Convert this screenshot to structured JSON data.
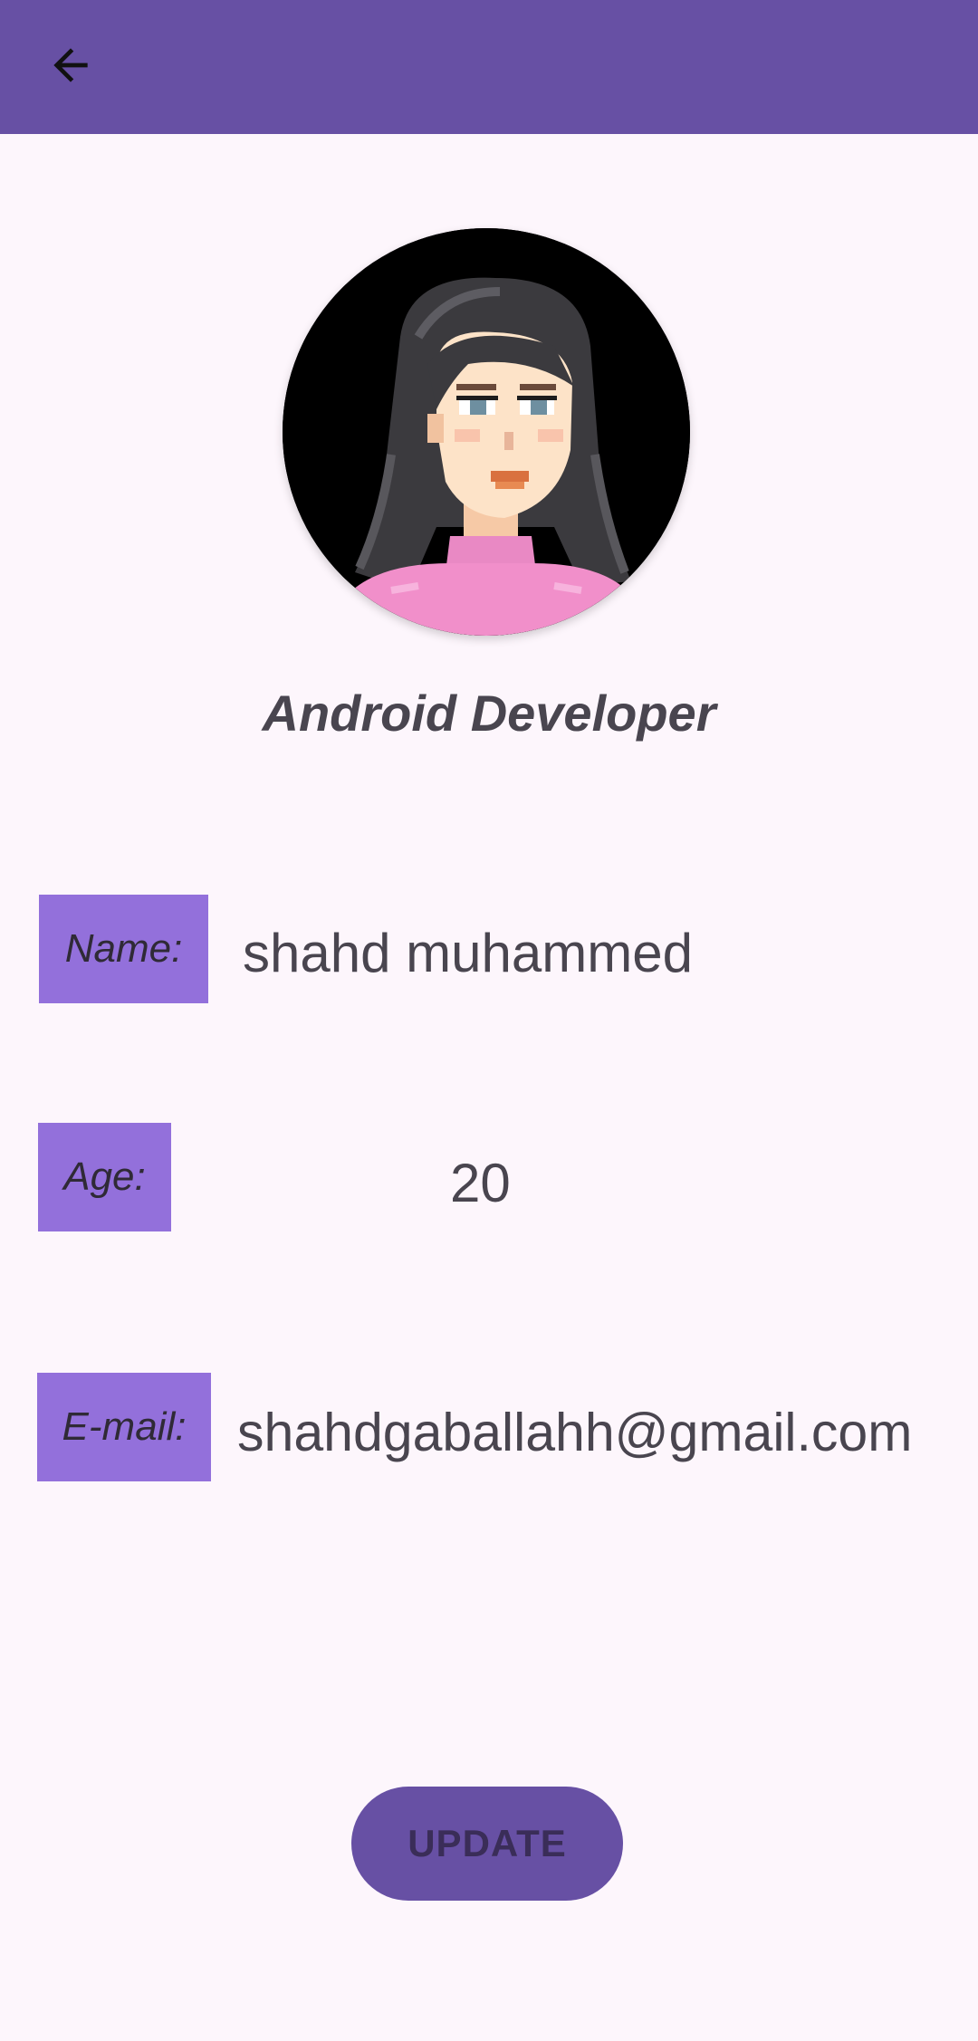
{
  "app_bar": {
    "back_icon": "arrow-back-icon",
    "color": "#6750a4"
  },
  "profile": {
    "avatar_icon": "pixel-art-girl-avatar",
    "role": "Android Developer"
  },
  "fields": {
    "name": {
      "label": "Name:",
      "value": "shahd muhammed"
    },
    "age": {
      "label": "Age:",
      "value": "20"
    },
    "email": {
      "label": "E-mail:",
      "value": "shahdgaballahh@gmail.com"
    }
  },
  "actions": {
    "update_label": "UPDATE"
  },
  "colors": {
    "primary": "#6750a4",
    "label_bg": "#9370db",
    "background": "#fdf6fc",
    "text": "#49454f"
  }
}
